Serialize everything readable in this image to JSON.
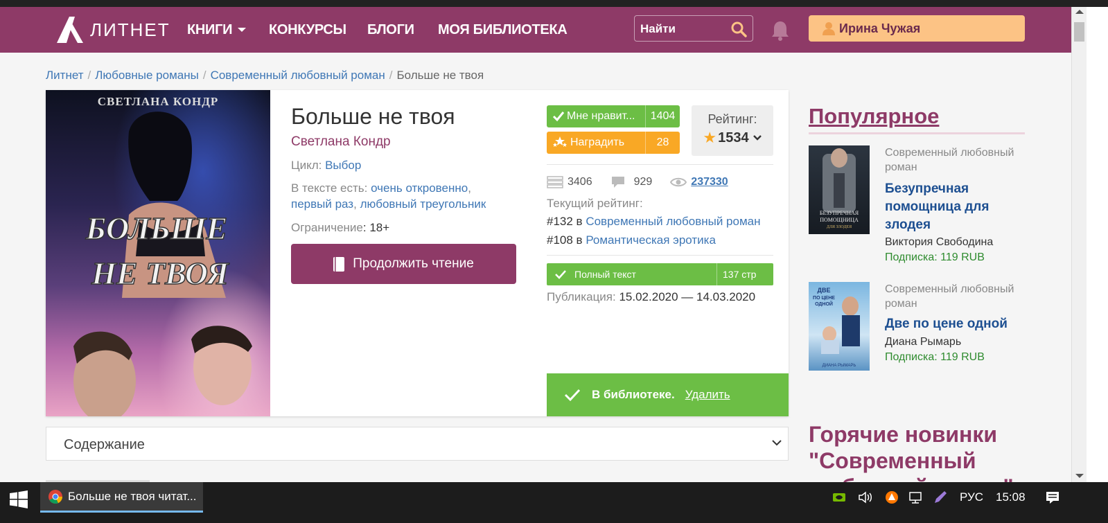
{
  "header": {
    "logo_text": "ЛИТНЕТ",
    "nav": [
      {
        "label": "КНИГИ",
        "has_dropdown": true
      },
      {
        "label": "КОНКУРСЫ"
      },
      {
        "label": "БЛОГИ"
      },
      {
        "label": "МОЯ БИБЛИОТЕКА"
      }
    ],
    "search_placeholder": "Найти",
    "user_name": "Ирина Чужая"
  },
  "breadcrumb": {
    "items": [
      "Литнет",
      "Любовные романы",
      "Современный любовный роман"
    ],
    "current": "Больше не твоя"
  },
  "book": {
    "title": "Больше не твоя",
    "author": "Светлана Кондр",
    "cycle_label": "Цикл:",
    "cycle_value": "Выбор",
    "tags_label": "В тексте есть:",
    "tags": [
      "очень откровенно",
      "первый раз",
      "любовный треугольник"
    ],
    "limit_label": "Ограничение",
    "limit_value": "18+",
    "read_button": "Продолжить чтение",
    "cover_author": "СВЕТЛАНА КОНДР",
    "cover_title_1": "БОЛЬШЕ",
    "cover_title_2": "НЕ ТВОЯ",
    "like_label": "Мне нравит...",
    "like_count": "1404",
    "award_label": "Наградить",
    "award_count": "28",
    "rating_label": "Рейтинг:",
    "rating_value": "1534",
    "library_count": "3406",
    "comments_count": "929",
    "views_count": "237330",
    "current_rating_label": "Текущий рейтинг:",
    "ranks": [
      {
        "pos": "#132 в",
        "genre": "Современный любовный роман"
      },
      {
        "pos": "#108 в",
        "genre": "Романтическая эротика"
      }
    ],
    "fulltext_label": "Полный текст",
    "pages": "137 стр",
    "pub_label": "Публикация:",
    "pub_value": "15.02.2020 — 14.03.2020",
    "library_status": "В библиотеке.",
    "library_remove": "Удалить",
    "toc_label": "Содержание"
  },
  "sidebar": {
    "popular_title": "Популярное",
    "books": [
      {
        "genre": "Современный любовный роман",
        "title": "Безупречная помощница для злодея",
        "author": "Виктория Свободина",
        "sub_label": "Подписка:",
        "price": "119 RUB",
        "cover_text_1": "БЕЗУПРЕЧНАЯ",
        "cover_text_2": "ПОМОЩНИЦА",
        "cover_text_3": "ДЛЯ ЗЛОДЕЯ"
      },
      {
        "genre": "Современный любовный роман",
        "title": "Две по цене одной",
        "author": "Диана Рымарь",
        "sub_label": "Подписка:",
        "price": "119 RUB",
        "cover_text_1": "ДВЕ",
        "cover_text_2": "ПО ЦЕНЕ",
        "cover_text_3": "ОДНОЙ",
        "cover_author": "ДИАНА РЫМАРЬ"
      }
    ],
    "hot_title": "Горячие новинки \"Современный любовный роман\""
  },
  "taskbar": {
    "task_title": "Больше не твоя читат...",
    "lang": "РУС",
    "time": "15:08"
  },
  "colors": {
    "brand": "#8e3a67",
    "accent_orange": "#fcc385",
    "green": "#6cbe45",
    "link": "#3f77b5"
  }
}
